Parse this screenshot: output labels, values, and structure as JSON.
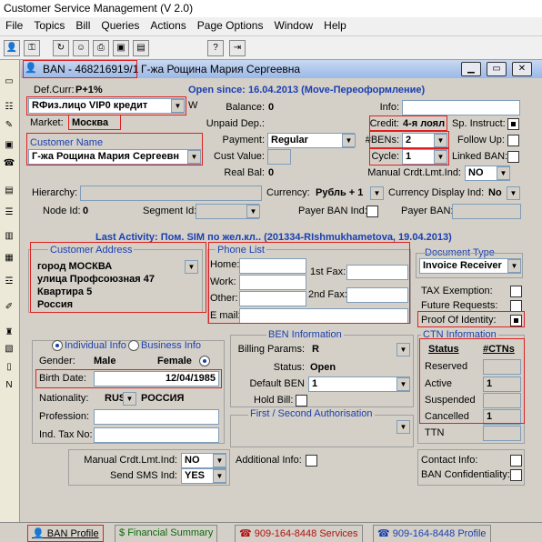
{
  "window_title": "Customer Service Management  (V 2.0)",
  "menu": [
    "File",
    "Topics",
    "Bill",
    "Queries",
    "Actions",
    "Page Options",
    "Window",
    "Help"
  ],
  "child_title": {
    "ban": "BAN - 468216919/1",
    "name": "Г-жа Рощина Мария Сергеевна"
  },
  "header": {
    "def_curr_label": "Def.Curr:",
    "def_curr": "P+1%",
    "open_since": "Open since: 16.04.2013 (Move-Переоформление)"
  },
  "left": {
    "account_type": "RФиз.лицо  VIP0  кредит",
    "w_label": "W",
    "market_label": "Market:",
    "market": "Москва",
    "customer_name_label": "Customer Name",
    "customer_name": "Г-жа Рощина Мария Сергеевн"
  },
  "balance": {
    "balance_label": "Balance:",
    "balance": "0",
    "unpaid_label": "Unpaid Dep.:",
    "unpaid": "",
    "payment_label": "Payment:",
    "payment": "Regular",
    "cust_value_label": "Cust Value:",
    "cust_value": "",
    "real_bal_label": "Real Bal:",
    "real_bal": "0"
  },
  "right": {
    "info_label": "Info:",
    "info": "",
    "credit_label": "Credit:",
    "credit": "4-я лоял",
    "bens_label": "#BENs:",
    "bens": "2",
    "cycle_label": "Cycle:",
    "cycle": "1",
    "manual_label": "Manual Crdt.Lmt.Ind:",
    "manual": "NO",
    "sp_instruct": "Sp. Instruct:",
    "follow_up": "Follow Up:",
    "linked_ban": "Linked BAN:"
  },
  "mid": {
    "hierarchy_label": "Hierarchy:",
    "currency_label": "Currency:",
    "currency": "Рубль + 1",
    "currency_disp_label": "Currency Display Ind:",
    "currency_disp": "No",
    "node_label": "Node Id:",
    "node": "0",
    "segment_label": "Segment Id:",
    "payer_ban_ind": "Payer BAN Ind:",
    "payer_ban_label": "Payer BAN:"
  },
  "last_activity": "Last Activity: Пом. SIM по жел.кл.. (201334-RIshmukhametova, 19.04.2013)",
  "address": {
    "title": "Customer Address",
    "lines": [
      "город МОСКВА",
      "улица Профсоюзная  47",
      "   Квартира 5",
      "Россия"
    ]
  },
  "phones": {
    "title": "Phone List",
    "home": "Home:",
    "work": "Work:",
    "other": "Other:",
    "email": "E mail:",
    "fax1": "1st Fax:",
    "fax2": "2nd Fax:"
  },
  "doc_type": {
    "title": "Document Type",
    "value": "Invoice Receiver"
  },
  "flags": {
    "tax": "TAX Exemption:",
    "future": "Future Requests:",
    "proof": "Proof Of Identity:"
  },
  "individual": {
    "indiv_label": "Individual Info",
    "business_label": "Business Info",
    "gender_label": "Gender:",
    "male": "Male",
    "female": "Female",
    "birth_label": "Birth Date:",
    "birth": "12/04/1985",
    "nationality_label": "Nationality:",
    "nationality_code": "RUS",
    "nationality": "РОССИЯ",
    "profession_label": "Profession:",
    "tax_no_label": "Ind. Tax No:"
  },
  "ben": {
    "title": "BEN Information",
    "billing_label": "Billing Params:",
    "billing": "R",
    "status_label": "Status:",
    "status": "Open",
    "default_label": "Default BEN",
    "default": "1",
    "hold_label": "Hold Bill:",
    "auth_title": "First / Second  Authorisation",
    "additional_label": "Additional Info:"
  },
  "ctn": {
    "title": "CTN Information",
    "col_status": "Status",
    "col_ctns": "#CTNs",
    "rows": [
      {
        "label": "Reserved",
        "value": ""
      },
      {
        "label": "Active",
        "value": "1"
      },
      {
        "label": "Suspended",
        "value": ""
      },
      {
        "label": "Cancelled",
        "value": "1"
      }
    ],
    "ttn": "TTN"
  },
  "bottom": {
    "manual_label": "Manual Crdt.Lmt.Ind:",
    "manual": "NO",
    "sms_label": "Send SMS Ind:",
    "sms": "YES",
    "contact_label": "Contact Info:",
    "confidentiality_label": "BAN Confidentiality:"
  },
  "tabs": [
    "BAN Profile",
    "Financial Summary",
    "909-164-8448 Services",
    "909-164-8448 Profile"
  ]
}
